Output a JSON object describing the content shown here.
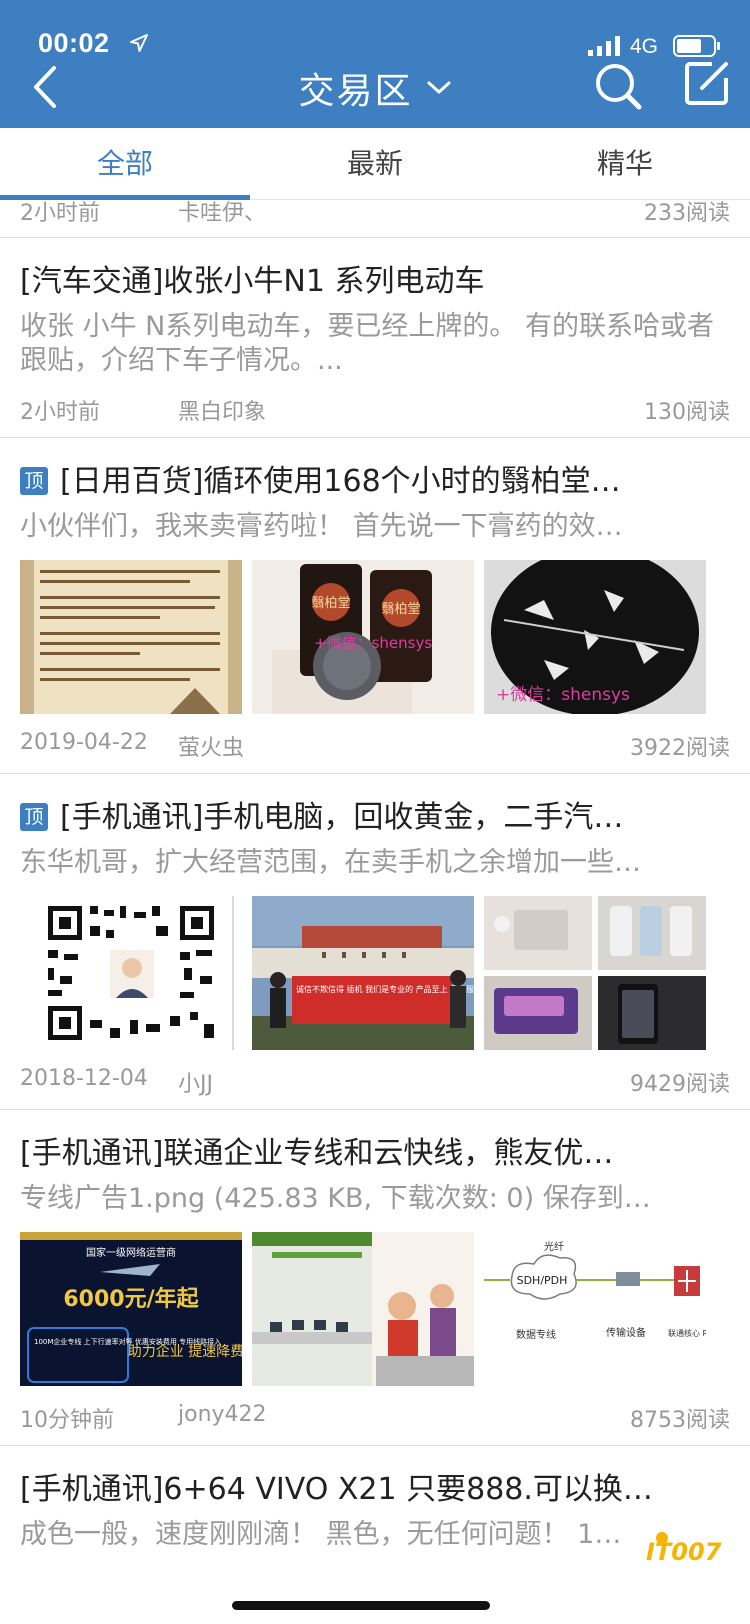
{
  "status_bar": {
    "time": "00:02",
    "network": "4G"
  },
  "nav": {
    "title": "交易区"
  },
  "tabs": [
    {
      "label": "全部",
      "active": true
    },
    {
      "label": "最新",
      "active": false
    },
    {
      "label": "精华",
      "active": false
    }
  ],
  "posts": [
    {
      "date": "2小时前",
      "author": "卡哇伊、",
      "reads": "233阅读"
    },
    {
      "title": "[汽车交通]收张小牛N1 系列电动车",
      "excerpt": "收张 小牛 N系列电动车，要已经上牌的。 有的联系哈或者跟贴，介绍下车子情况。...",
      "date": "2小时前",
      "author": "黑白印象",
      "reads": "130阅读"
    },
    {
      "pinned_label": "顶",
      "title": "[日用百货]循环使用168个小时的翳柏堂…",
      "excerpt": "小伙伴们，我来卖膏药啦！    首先说一下膏药的效…",
      "date": "2019-04-22",
      "author": "萤火虫",
      "reads": "3922阅读",
      "thumb_texts": {
        "wechat_1": "+微信：shensys",
        "wechat_2": "+微信：shensys",
        "brand": "翳柏堂"
      }
    },
    {
      "pinned_label": "顶",
      "title": "[手机通讯]手机电脑，回收黄金，二手汽…",
      "excerpt": "东华机哥，扩大经营范围，在卖手机之余增加一些…",
      "date": "2018-12-04",
      "author": "小JJ",
      "reads": "9429阅读",
      "thumb_texts": {
        "banner": "诚信不欺信得 插机 我们是专业的 产品至上 用心服务 认准东华机哥！"
      }
    },
    {
      "title": "[手机通讯]联通企业专线和云快线，熊友优…",
      "excerpt": "专线广告1.png (425.83 KB, 下载次数: 0)   保存到…",
      "date": "10分钟前",
      "author": "jony422",
      "reads": "8753阅读",
      "thumb_texts": {
        "ad_org": "国家一级网络运营商",
        "ad_price": "6000元/年起",
        "ad_feature": "100M企业专线 上下行速率对等 优惠安装费用 专用线路接入",
        "ad_slogan": "助力企业 提速降费",
        "net_fiber": "光纤",
        "net_sdh": "SDH/PDH",
        "net_line": "数据专线",
        "net_device": "传输设备",
        "net_router_label": "联通核心 Router"
      }
    },
    {
      "title": "[手机通讯]6+64 VIVO X21  只要888.可以换…",
      "excerpt": "成色一般，速度刚刚滴！  黑色，无任何问题！  1…"
    }
  ],
  "watermark": "IT007"
}
